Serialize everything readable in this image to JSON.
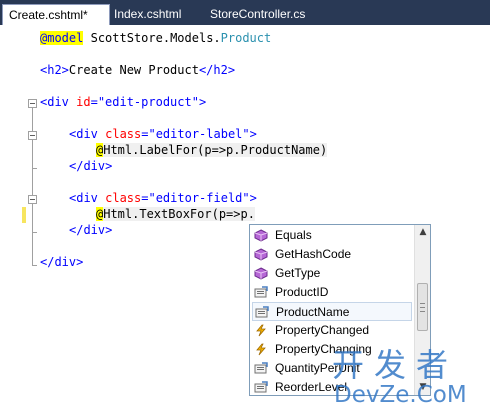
{
  "tabs": [
    {
      "label": "Create.cshtml*",
      "active": true
    },
    {
      "label": "Index.cshtml",
      "active": false
    },
    {
      "label": "StoreController.cs",
      "active": false
    }
  ],
  "tab_close_glyph": "×",
  "code": {
    "line1": {
      "directive": "@model",
      "namespace": "ScottStore.Models.",
      "type": "Product"
    },
    "line2": {
      "open": "<h2>",
      "text": "Create New Product",
      "close": "</h2>"
    },
    "line3": {
      "open": "<div ",
      "attr": "id",
      "eq": "=",
      "val": "\"edit-product\"",
      "end": ">"
    },
    "line4": {
      "open": "<div ",
      "attr": "class",
      "eq": "=",
      "val": "\"editor-label\"",
      "end": ">"
    },
    "line5": {
      "at": "@",
      "expr": "Html.LabelFor(p=>p.ProductName)"
    },
    "line6": {
      "text": "</div>"
    },
    "line7": {
      "open": "<div ",
      "attr": "class",
      "eq": "=",
      "val": "\"editor-field\"",
      "end": ">"
    },
    "line8": {
      "at": "@",
      "expr": "Html.TextBoxFor(p=>p."
    },
    "line9": {
      "text": "</div>"
    },
    "line10": {
      "text": "</div>"
    }
  },
  "intellisense": {
    "items": [
      {
        "label": "Equals",
        "icon": "method-icon"
      },
      {
        "label": "GetHashCode",
        "icon": "method-icon"
      },
      {
        "label": "GetType",
        "icon": "method-icon"
      },
      {
        "label": "ProductID",
        "icon": "property-icon"
      },
      {
        "label": "ProductName",
        "icon": "property-icon",
        "selected": true
      },
      {
        "label": "PropertyChanged",
        "icon": "event-icon"
      },
      {
        "label": "PropertyChanging",
        "icon": "event-icon"
      },
      {
        "label": "QuantityPerUnit",
        "icon": "property-icon"
      },
      {
        "label": "ReorderLevel",
        "icon": "property-icon"
      }
    ],
    "scroll_up": "▲",
    "scroll_down": "▼"
  },
  "watermark": {
    "cn": "开发者",
    "en": "DevZe.CoM"
  },
  "colors": {
    "tabbar": "#293955",
    "keyword": "#0000ff",
    "tag_name": "#a31515",
    "attribute": "#ff0000",
    "razor_highlight": "#ffff00",
    "type_name": "#2b91af",
    "watermark": "#3478c6"
  }
}
